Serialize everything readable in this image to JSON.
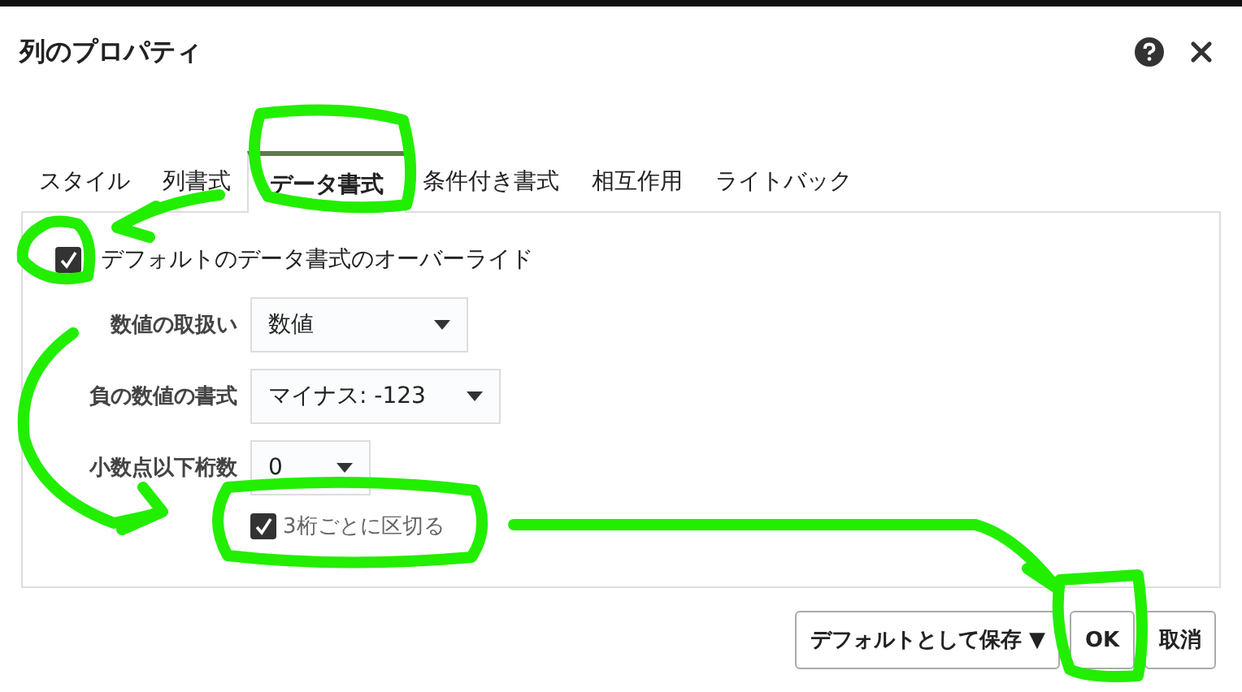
{
  "window": {
    "title": "列のプロパティ"
  },
  "tabs": [
    {
      "label": "スタイル",
      "selected": false
    },
    {
      "label": "列書式",
      "selected": false
    },
    {
      "label": "データ書式",
      "selected": true
    },
    {
      "label": "条件付き書式",
      "selected": false
    },
    {
      "label": "相互作用",
      "selected": false
    },
    {
      "label": "ライトバック",
      "selected": false
    }
  ],
  "override": {
    "label": "デフォルトのデータ書式のオーバーライド",
    "checked": true
  },
  "fields": [
    {
      "label": "数値の取扱い",
      "value": "数値"
    },
    {
      "label": "負の数値の書式",
      "value": "マイナス: -123"
    },
    {
      "label": "小数点以下桁数",
      "value": "0"
    }
  ],
  "thousands": {
    "label": "3桁ごとに区切る",
    "checked": true
  },
  "buttons": [
    {
      "label": "デフォルトとして保存 ▼",
      "kind": "menu"
    },
    {
      "label": "OK",
      "kind": "primary"
    },
    {
      "label": "取消",
      "kind": "plain"
    }
  ]
}
